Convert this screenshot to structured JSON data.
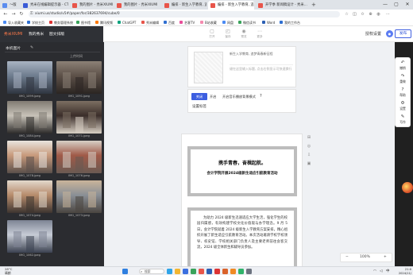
{
  "browser": {
    "tabs": [
      {
        "title": "～版",
        "color": "#5b8def",
        "active": false
      },
      {
        "title": "秀米在线编辑提示器 - CTC 以及…",
        "color": "#3a5bd6",
        "active": false
      },
      {
        "title": "我的图片 - 秀米XIUMI",
        "color": "#e8554a",
        "active": false
      },
      {
        "title": "我的图片 - 秀米XIUMI",
        "color": "#e8554a",
        "active": false
      },
      {
        "title": "编排 - 新生入学教育, 追梦…",
        "color": "#e8554a",
        "active": false
      },
      {
        "title": "编排 - 新生入学教育, 追梦…",
        "color": "#e8554a",
        "active": true
      },
      {
        "title": "开学季 新闻稿设计 - 秀米…",
        "color": "#e8554a",
        "active": false
      }
    ],
    "url": "xiumi.us/studio/v5#/paper/for/382637694/cube/0",
    "bookmarks": [
      {
        "label": "导入收藏夹",
        "color": "#4a8af4"
      },
      {
        "label": "学校主页",
        "color": "#2f6fd1"
      },
      {
        "label": "教务管理系统",
        "color": "#d33"
      },
      {
        "label": "图书馆",
        "color": "#3aa35b"
      },
      {
        "label": "腾讯视频",
        "color": "#ff7a00"
      },
      {
        "label": "ChatGPT",
        "color": "#10a37f"
      },
      {
        "label": "秀米编辑",
        "color": "#e8554a"
      },
      {
        "label": "百度",
        "color": "#2f6fd1"
      },
      {
        "label": "艺客TV",
        "color": "#e84f9a"
      },
      {
        "label": "B站收藏",
        "color": "#f58bb0"
      },
      {
        "label": "网盘",
        "color": "#4a8af4"
      },
      {
        "label": "微信读书",
        "color": "#3aa35b"
      },
      {
        "label": "Word",
        "color": "#2b5fb4"
      },
      {
        "label": "我的工作台",
        "color": "#2f6fd1"
      }
    ]
  },
  "app": {
    "menu": [
      {
        "label": "秀米XIUMI",
        "accent": true
      },
      {
        "label": "我的秀米",
        "accent": false
      },
      {
        "label": "图文排版",
        "accent": false
      }
    ],
    "tools": [
      {
        "label": "打开",
        "icon": "folder-icon",
        "glyph": "▢"
      },
      {
        "label": "保存",
        "icon": "save-icon",
        "glyph": "◰"
      },
      {
        "label": "预览",
        "icon": "eye-icon",
        "glyph": "◉"
      },
      {
        "label": "更多",
        "icon": "more-icon",
        "glyph": "⋯"
      }
    ],
    "authorize": "授权设置",
    "launch": "发布"
  },
  "left_panel": {
    "title": "本机图片",
    "sort": "上传时间",
    "images": [
      {
        "caption": "IMG_1099.jpeg",
        "palette": [
          "#6e7c8e",
          "#a9b3c2",
          "#2f3540"
        ]
      },
      {
        "caption": "IMG_1091.jpeg",
        "palette": [
          "#5c5048",
          "#8c8176",
          "#2b2522"
        ]
      },
      {
        "caption": "IMG_1084.jpeg",
        "palette": [
          "#c7c2b8",
          "#807a72",
          "#2d2b2a"
        ]
      },
      {
        "caption": "IMG_1071.jpeg",
        "palette": [
          "#3b2e2a",
          "#7c6f62",
          "#d8d0c4"
        ]
      },
      {
        "caption": "IMG_1078.jpeg",
        "palette": [
          "#c89a7c",
          "#e9e4de",
          "#5a4f4a"
        ]
      },
      {
        "caption": "IMG_1076.jpeg",
        "palette": [
          "#a05a48",
          "#d6cfc6",
          "#6a5a52"
        ]
      },
      {
        "caption": "IMG_1074.jpeg",
        "palette": [
          "#b78c6c",
          "#e2d8cc",
          "#3d3430"
        ]
      },
      {
        "caption": "IMG_1073.jpeg",
        "palette": [
          "#8a8f96",
          "#c9b49a",
          "#4a4540"
        ]
      },
      {
        "caption": "IMG_1062.jpeg",
        "palette": [
          "#c7ccd6",
          "#7d8494",
          "#3b4150"
        ]
      }
    ]
  },
  "editor": {
    "card_text_1": "新生入学教育, 追梦青春新征程",
    "card_text_2": "键在这里输入标题, 点击右侧显示可快速换行",
    "options": {
      "on": "关闭",
      "off": "开启",
      "label": "开启音乐播放背景模式",
      "help": "?",
      "link": "设置标签"
    },
    "banner_title": "携手青春，奋楫起航。",
    "banner_subtitle": "会计学院开展2024级新生适应引航教育活动",
    "body_text": "为助力 2024 级新生迅速适应大学生活，强化学生的校园归属感，有效构建学校文化价值观与办学理念。9 月 5 日，会计学院就着 2024 级新生入学教育方案安排，精心组织开展了新生适应引航教育活动。本次活动邀请学校学校领导、校史馆、学校相关部门负责人及主要老师前往会客交流，2024 级全体新生和辅导员参加。",
    "side_tools": [
      "⊞",
      "◎",
      "⇩",
      "▣"
    ],
    "zoom": "100%",
    "zoom_minus": "−",
    "zoom_plus": "+"
  },
  "right_rail": [
    {
      "label": "撤销",
      "glyph": "↶",
      "icon": "undo-icon"
    },
    {
      "label": "重做",
      "glyph": "↷",
      "icon": "redo-icon"
    },
    {
      "label": "帮助",
      "glyph": "?",
      "icon": "help-icon"
    },
    {
      "label": "设置",
      "glyph": "⚙",
      "icon": "settings-icon"
    },
    {
      "label": "写作",
      "glyph": "✎",
      "icon": "write-icon"
    }
  ],
  "taskbar": {
    "weather_temp": "28°C",
    "weather_desc": "晴朗",
    "search": "搜索",
    "apps": [
      {
        "name": "start-icon",
        "color": "#2f7fe0"
      },
      {
        "name": "edge-icon",
        "color": "#2fa4e8"
      },
      {
        "name": "files-icon",
        "color": "#f2b632"
      },
      {
        "name": "app-blue-icon",
        "color": "#3b6fe0"
      },
      {
        "name": "wechat-icon",
        "color": "#3aa35b"
      },
      {
        "name": "chrome-icon",
        "color": "#e8554a"
      },
      {
        "name": "word-icon",
        "color": "#2b5fb4"
      },
      {
        "name": "netease-icon",
        "color": "#d33"
      },
      {
        "name": "ppt-icon",
        "color": "#d9622b"
      },
      {
        "name": "app-orange-icon",
        "color": "#f08a24"
      },
      {
        "name": "app-green-icon",
        "color": "#2fb36a"
      },
      {
        "name": "app-gray-icon",
        "color": "#6c7380"
      }
    ],
    "tray_lang": "中",
    "time": "21:0",
    "date": "2024/11/"
  }
}
